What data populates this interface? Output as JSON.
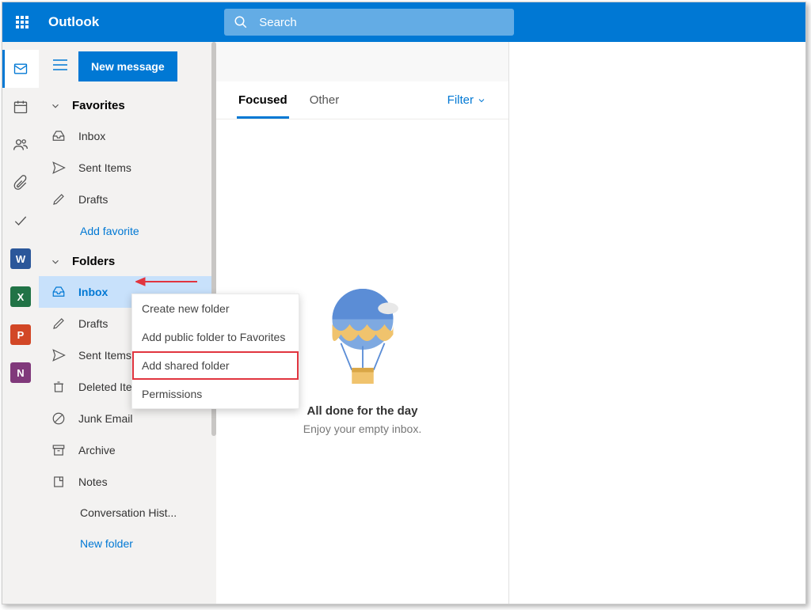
{
  "header": {
    "app_name": "Outlook",
    "search_placeholder": "Search"
  },
  "newMessage": {
    "label": "New message"
  },
  "sections": {
    "favorites": {
      "label": "Favorites",
      "items": [
        {
          "label": "Inbox"
        },
        {
          "label": "Sent Items"
        },
        {
          "label": "Drafts"
        }
      ],
      "add_link": "Add favorite"
    },
    "folders": {
      "label": "Folders",
      "items": [
        {
          "label": "Inbox"
        },
        {
          "label": "Drafts"
        },
        {
          "label": "Sent Items"
        },
        {
          "label": "Deleted Items"
        },
        {
          "label": "Junk Email"
        },
        {
          "label": "Archive"
        },
        {
          "label": "Notes"
        },
        {
          "label": "Conversation Hist..."
        }
      ],
      "new_link": "New folder"
    }
  },
  "messageList": {
    "tabs": {
      "focused": "Focused",
      "other": "Other"
    },
    "filter": "Filter",
    "empty": {
      "title": "All done for the day",
      "subtitle": "Enjoy your empty inbox."
    }
  },
  "contextMenu": {
    "items": [
      "Create new folder",
      "Add public folder to Favorites",
      "Add shared folder",
      "Permissions"
    ]
  },
  "appRail": {
    "word": "W",
    "excel": "X",
    "ppt": "P",
    "note": "N"
  }
}
